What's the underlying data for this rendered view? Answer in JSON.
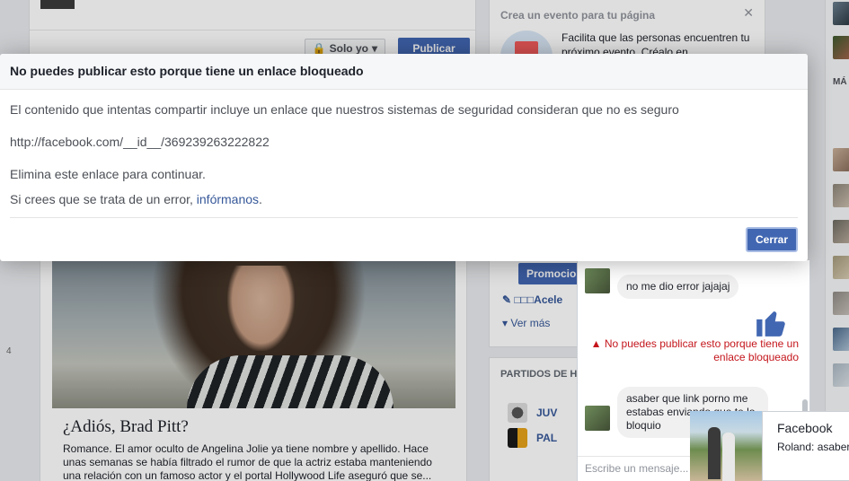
{
  "composer": {
    "privacy_label": "Solo yo",
    "publish_label": "Publicar"
  },
  "post": {
    "title": "¿Adiós, Brad Pitt?",
    "text": "Romance. El amor oculto de Angelina Jolie ya tiene nombre y apellido. Hace unas semanas se había filtrado el rumor de que la actriz estaba manteniendo una relación con un famoso actor y el portal Hollywood Life aseguró que se..."
  },
  "sidebar": {
    "event_title": "Crea un evento para tu página",
    "event_text": "Facilita que las personas encuentren tu próximo evento. Créalo en",
    "promo_button": "Promocionar",
    "promo_line": "□□□Acele",
    "see_more": "Ver más",
    "matches_title": "PARTIDOS DE HO",
    "teams": [
      {
        "name": "JUV"
      },
      {
        "name": "PAL"
      }
    ],
    "far_right_label": "MÁ"
  },
  "page_number": "4",
  "chat": {
    "message_1": "no me dio error jajajaj",
    "error_text": "No puedes publicar esto porque tiene un enlace bloqueado",
    "message_2": "asaber que link porno me estabas enviando que te lo bloquio",
    "input_placeholder": "Escribe un mensaje...",
    "like_color": "#4267b2"
  },
  "toast": {
    "title": "Facebook",
    "message": "Roland: asaber enviando que te"
  },
  "modal": {
    "title": "No puedes publicar esto porque tiene un enlace bloqueado",
    "message": "El contenido que intentas compartir incluye un enlace que nuestros sistemas de seguridad consideran que no es seguro",
    "url": "http://facebook.com/__id__/369239263222822",
    "remove_text": "Elimina este enlace para continuar.",
    "error_prefix": "Si crees que se trata de un error, ",
    "error_link": "infórmanos",
    "error_suffix": ".",
    "close_label": "Cerrar"
  },
  "colors": {
    "brand": "#4267b2",
    "link": "#365899",
    "error": "#c4161c"
  }
}
